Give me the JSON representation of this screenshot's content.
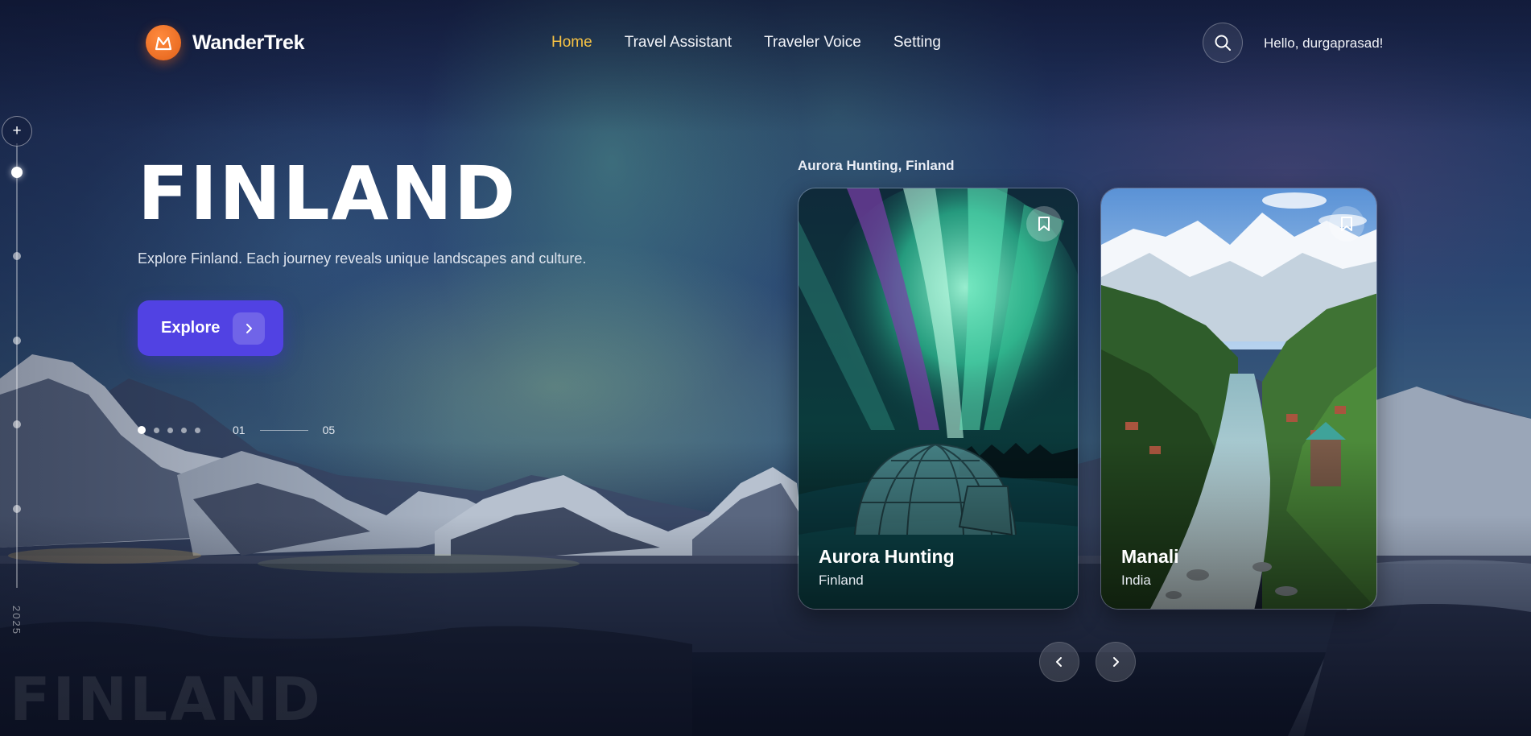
{
  "header": {
    "brand": "WanderTrek",
    "nav": [
      {
        "label": "Home",
        "active": true
      },
      {
        "label": "Travel Assistant",
        "active": false
      },
      {
        "label": "Traveler Voice",
        "active": false
      },
      {
        "label": "Setting",
        "active": false
      }
    ],
    "greeting": "Hello, durgaprasad!"
  },
  "timeline": {
    "year": "2025"
  },
  "hero": {
    "title": "FINLAND",
    "description": "Explore Finland. Each journey reveals unique landscapes and culture.",
    "explore_label": "Explore",
    "current_slide": "01",
    "total_slides": "05",
    "ghost_title": "FINLAND"
  },
  "cards": {
    "heading": "Aurora Hunting, Finland",
    "items": [
      {
        "title": "Aurora Hunting",
        "subtitle": "Finland"
      },
      {
        "title": "Manali",
        "subtitle": "India"
      }
    ]
  },
  "colors": {
    "accent": "#f6c244",
    "brand": "#e3621a",
    "button": "#5142e3"
  }
}
